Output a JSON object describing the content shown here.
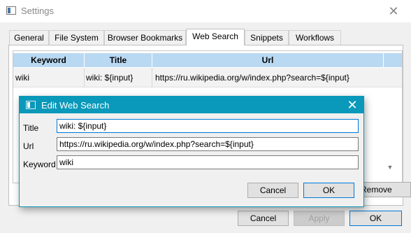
{
  "window": {
    "title": "Settings",
    "close_glyph": "✕"
  },
  "tabs": [
    {
      "label": "General"
    },
    {
      "label": "File System"
    },
    {
      "label": "Browser Bookmarks"
    },
    {
      "label": "Web Search",
      "active": true
    },
    {
      "label": "Snippets"
    },
    {
      "label": "Workflows"
    }
  ],
  "table": {
    "columns": [
      "Keyword",
      "Title",
      "Url"
    ],
    "rows": [
      {
        "keyword": "wiki",
        "title": "wiki: ${input}",
        "url": "https://ru.wikipedia.org/w/index.php?search=${input}"
      }
    ]
  },
  "remove_label": "Remove",
  "footer": {
    "cancel": "Cancel",
    "apply": "Apply",
    "ok": "OK"
  },
  "dialog": {
    "title": "Edit Web Search",
    "close_glyph": "✕",
    "fields": {
      "title_label": "Title",
      "title_value": "wiki: ${input}",
      "url_label": "Url",
      "url_value": "https://ru.wikipedia.org/w/index.php?search=${input}",
      "keyword_label": "Keyword",
      "keyword_value": "wiki"
    },
    "cancel": "Cancel",
    "ok": "OK"
  },
  "colors": {
    "accent": "#0a99ba",
    "header_bg": "#b9d8f2",
    "focus": "#0078d7"
  },
  "icons": [
    "window-icon",
    "close-icon",
    "dialog-window-icon",
    "dialog-close-icon",
    "scroll-down-arrow-icon"
  ]
}
